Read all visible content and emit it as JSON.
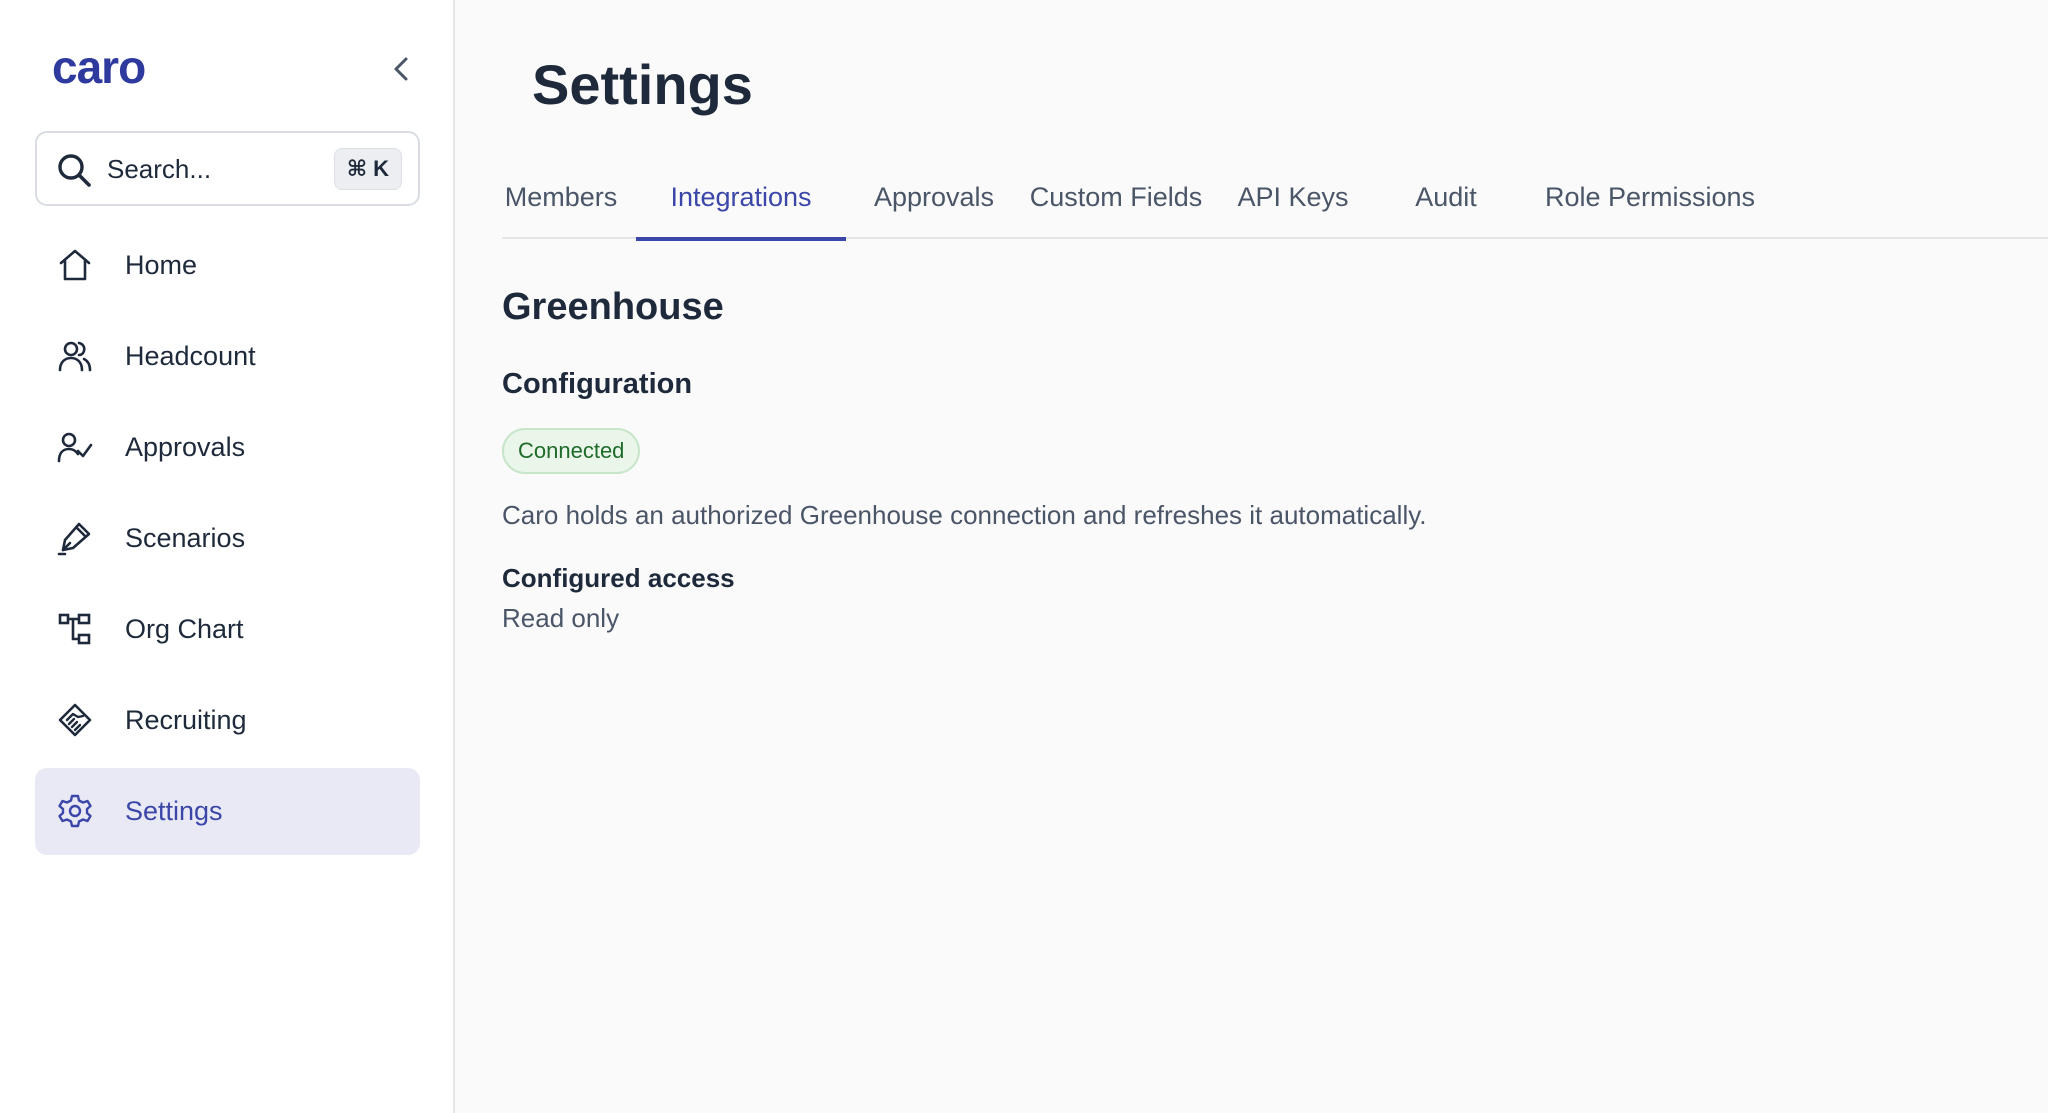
{
  "app": {
    "logo": "caro"
  },
  "search": {
    "placeholder": "Search...",
    "shortcut_symbol": "⌘",
    "shortcut_key": "K"
  },
  "sidebar": {
    "items": [
      {
        "label": "Home",
        "icon": "home-icon"
      },
      {
        "label": "Headcount",
        "icon": "users-icon"
      },
      {
        "label": "Approvals",
        "icon": "user-check-icon"
      },
      {
        "label": "Scenarios",
        "icon": "pen-icon"
      },
      {
        "label": "Org Chart",
        "icon": "org-chart-icon"
      },
      {
        "label": "Recruiting",
        "icon": "handshake-icon"
      },
      {
        "label": "Settings",
        "icon": "gear-icon",
        "active": true
      }
    ]
  },
  "page": {
    "title": "Settings"
  },
  "tabs": [
    {
      "label": "Members"
    },
    {
      "label": "Integrations",
      "active": true
    },
    {
      "label": "Approvals"
    },
    {
      "label": "Custom Fields"
    },
    {
      "label": "API Keys"
    },
    {
      "label": "Audit"
    },
    {
      "label": "Role Permissions"
    }
  ],
  "integration": {
    "name": "Greenhouse",
    "section": "Configuration",
    "status": "Connected",
    "description": "Caro holds an authorized Greenhouse connection and refreshes it automatically.",
    "access_label": "Configured access",
    "access_value": "Read only"
  },
  "colors": {
    "accent": "#3a46a8",
    "text": "#1e2a3b",
    "muted": "#4a5568",
    "status_bg": "#eaf6ea",
    "status_text": "#1f6b2a"
  }
}
